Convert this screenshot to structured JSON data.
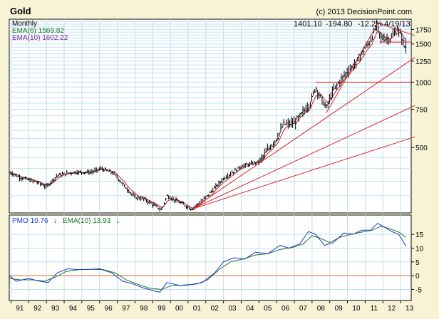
{
  "chart_data": [
    {
      "type": "line",
      "title": "Gold",
      "credit": "(c) 2013 DecisionPoint.com",
      "period_label": "Monthly",
      "readout": {
        "close": "1401.10",
        "change": "-194.80",
        "pct": "-12.2%",
        "date": "4/19/13"
      },
      "legend": [
        {
          "label": "EMA(6) 1569.82",
          "color": "#1a7a1a"
        },
        {
          "label": "EMA(10) 1602.22",
          "color": "#7a2a8a"
        }
      ],
      "x_ticks": [
        "91",
        "92",
        "93",
        "94",
        "95",
        "96",
        "97",
        "98",
        "99",
        "00",
        "01",
        "02",
        "03",
        "04",
        "05",
        "06",
        "07",
        "08",
        "09",
        "10",
        "11",
        "12",
        "13"
      ],
      "y_ticks": [
        500,
        750,
        1000,
        1250,
        1500,
        1750
      ],
      "ylim": [
        250,
        1950
      ],
      "scale": "log",
      "grid": true,
      "colors": {
        "price": "#000000",
        "ema": "#cc2222",
        "trend": "#dd2222"
      },
      "monthly_close_yearly": [
        {
          "x": 1990.9,
          "y": 385
        },
        {
          "x": 1991.5,
          "y": 365
        },
        {
          "x": 1992.5,
          "y": 345
        },
        {
          "x": 1993.0,
          "y": 330
        },
        {
          "x": 1993.6,
          "y": 372
        },
        {
          "x": 1994.5,
          "y": 385
        },
        {
          "x": 1995.5,
          "y": 385
        },
        {
          "x": 1996.1,
          "y": 400
        },
        {
          "x": 1996.8,
          "y": 380
        },
        {
          "x": 1997.5,
          "y": 325
        },
        {
          "x": 1998.0,
          "y": 295
        },
        {
          "x": 1998.5,
          "y": 290
        },
        {
          "x": 1999.5,
          "y": 258
        },
        {
          "x": 1999.8,
          "y": 300
        },
        {
          "x": 2000.5,
          "y": 280
        },
        {
          "x": 2001.2,
          "y": 260
        },
        {
          "x": 2002.0,
          "y": 295
        },
        {
          "x": 2003.0,
          "y": 360
        },
        {
          "x": 2004.0,
          "y": 410
        },
        {
          "x": 2005.0,
          "y": 430
        },
        {
          "x": 2006.0,
          "y": 550
        },
        {
          "x": 2006.4,
          "y": 640
        },
        {
          "x": 2007.0,
          "y": 650
        },
        {
          "x": 2007.9,
          "y": 800
        },
        {
          "x": 2008.2,
          "y": 950
        },
        {
          "x": 2008.8,
          "y": 760
        },
        {
          "x": 2009.2,
          "y": 920
        },
        {
          "x": 2009.9,
          "y": 1100
        },
        {
          "x": 2010.5,
          "y": 1230
        },
        {
          "x": 2010.9,
          "y": 1400
        },
        {
          "x": 2011.3,
          "y": 1550
        },
        {
          "x": 2011.65,
          "y": 1830
        },
        {
          "x": 2011.9,
          "y": 1600
        },
        {
          "x": 2012.4,
          "y": 1580
        },
        {
          "x": 2012.8,
          "y": 1760
        },
        {
          "x": 2013.0,
          "y": 1670
        },
        {
          "x": 2013.3,
          "y": 1401
        }
      ],
      "horizontal_levels": [
        1000,
        1530
      ],
      "trend_lines": [
        {
          "from": [
            2001.2,
            260
          ],
          "to": [
            2013.8,
            560
          ]
        },
        {
          "from": [
            2001.2,
            260
          ],
          "to": [
            2013.8,
            780
          ]
        },
        {
          "from": [
            2001.2,
            260
          ],
          "to": [
            2013.8,
            1300
          ]
        },
        {
          "from": [
            2008.8,
            720
          ],
          "to": [
            2011.65,
            1830
          ]
        },
        {
          "from": [
            2011.65,
            1880
          ],
          "to": [
            2013.8,
            1640
          ]
        }
      ]
    },
    {
      "type": "line",
      "title": "",
      "legend": [
        {
          "label": "PMO 10.76",
          "color": "#1a3acc",
          "arrow": "down"
        },
        {
          "label": "EMA(10) 13.93",
          "color": "#1a7a1a",
          "arrow": "down"
        }
      ],
      "y_ticks": [
        -5,
        0,
        5,
        10,
        15
      ],
      "ylim": [
        -9,
        22
      ],
      "zero_line": 0,
      "series": [
        {
          "name": "PMO",
          "color": "#1a3acc",
          "values": [
            {
              "x": 1990.9,
              "y": 0
            },
            {
              "x": 1991.3,
              "y": -2
            },
            {
              "x": 1992.0,
              "y": -1
            },
            {
              "x": 1992.6,
              "y": -2
            },
            {
              "x": 1993.1,
              "y": -2.5
            },
            {
              "x": 1993.6,
              "y": 1
            },
            {
              "x": 1994.2,
              "y": 2.5
            },
            {
              "x": 1994.8,
              "y": 2.2
            },
            {
              "x": 1995.5,
              "y": 2.3
            },
            {
              "x": 1996.0,
              "y": 2.5
            },
            {
              "x": 1996.7,
              "y": 1
            },
            {
              "x": 1997.3,
              "y": -2
            },
            {
              "x": 1997.9,
              "y": -3
            },
            {
              "x": 1998.5,
              "y": -4.5
            },
            {
              "x": 1999.4,
              "y": -6
            },
            {
              "x": 1999.8,
              "y": -2.5
            },
            {
              "x": 2000.5,
              "y": -3.5
            },
            {
              "x": 2001.2,
              "y": -3.2
            },
            {
              "x": 2001.8,
              "y": -2.5
            },
            {
              "x": 2002.5,
              "y": 1
            },
            {
              "x": 2003.0,
              "y": 5
            },
            {
              "x": 2003.6,
              "y": 6.5
            },
            {
              "x": 2004.2,
              "y": 6
            },
            {
              "x": 2004.8,
              "y": 8.5
            },
            {
              "x": 2005.5,
              "y": 8
            },
            {
              "x": 2006.2,
              "y": 11
            },
            {
              "x": 2006.7,
              "y": 10
            },
            {
              "x": 2007.3,
              "y": 11.5
            },
            {
              "x": 2007.8,
              "y": 16
            },
            {
              "x": 2008.2,
              "y": 15
            },
            {
              "x": 2008.7,
              "y": 11
            },
            {
              "x": 2009.2,
              "y": 12
            },
            {
              "x": 2009.8,
              "y": 15.5
            },
            {
              "x": 2010.3,
              "y": 15
            },
            {
              "x": 2010.8,
              "y": 16.5
            },
            {
              "x": 2011.3,
              "y": 16.5
            },
            {
              "x": 2011.7,
              "y": 19
            },
            {
              "x": 2012.0,
              "y": 18
            },
            {
              "x": 2012.5,
              "y": 16
            },
            {
              "x": 2012.9,
              "y": 15
            },
            {
              "x": 2013.3,
              "y": 10.76
            }
          ]
        },
        {
          "name": "EMA(10)",
          "color": "#1a7a1a",
          "values": [
            {
              "x": 1990.9,
              "y": -1
            },
            {
              "x": 1991.5,
              "y": -1.5
            },
            {
              "x": 1992.2,
              "y": -1.5
            },
            {
              "x": 1992.9,
              "y": -2
            },
            {
              "x": 1993.5,
              "y": -0.5
            },
            {
              "x": 1994.1,
              "y": 1.5
            },
            {
              "x": 1994.8,
              "y": 2.2
            },
            {
              "x": 1995.5,
              "y": 2.3
            },
            {
              "x": 1996.2,
              "y": 2.2
            },
            {
              "x": 1996.9,
              "y": 1
            },
            {
              "x": 1997.5,
              "y": -1.5
            },
            {
              "x": 1998.1,
              "y": -3
            },
            {
              "x": 1998.8,
              "y": -4.5
            },
            {
              "x": 1999.5,
              "y": -5
            },
            {
              "x": 2000.1,
              "y": -3.5
            },
            {
              "x": 2000.8,
              "y": -3.5
            },
            {
              "x": 2001.5,
              "y": -3
            },
            {
              "x": 2002.1,
              "y": -1.5
            },
            {
              "x": 2002.8,
              "y": 2.5
            },
            {
              "x": 2003.4,
              "y": 5
            },
            {
              "x": 2004.1,
              "y": 6
            },
            {
              "x": 2004.8,
              "y": 7.5
            },
            {
              "x": 2005.5,
              "y": 8
            },
            {
              "x": 2006.2,
              "y": 9.5
            },
            {
              "x": 2006.9,
              "y": 10.2
            },
            {
              "x": 2007.5,
              "y": 11.5
            },
            {
              "x": 2008.0,
              "y": 14.5
            },
            {
              "x": 2008.5,
              "y": 13.5
            },
            {
              "x": 2009.0,
              "y": 12
            },
            {
              "x": 2009.6,
              "y": 14
            },
            {
              "x": 2010.2,
              "y": 15
            },
            {
              "x": 2010.8,
              "y": 15.8
            },
            {
              "x": 2011.4,
              "y": 16.5
            },
            {
              "x": 2011.9,
              "y": 18
            },
            {
              "x": 2012.4,
              "y": 17
            },
            {
              "x": 2012.9,
              "y": 15.8
            },
            {
              "x": 2013.3,
              "y": 13.93
            }
          ]
        }
      ]
    }
  ]
}
